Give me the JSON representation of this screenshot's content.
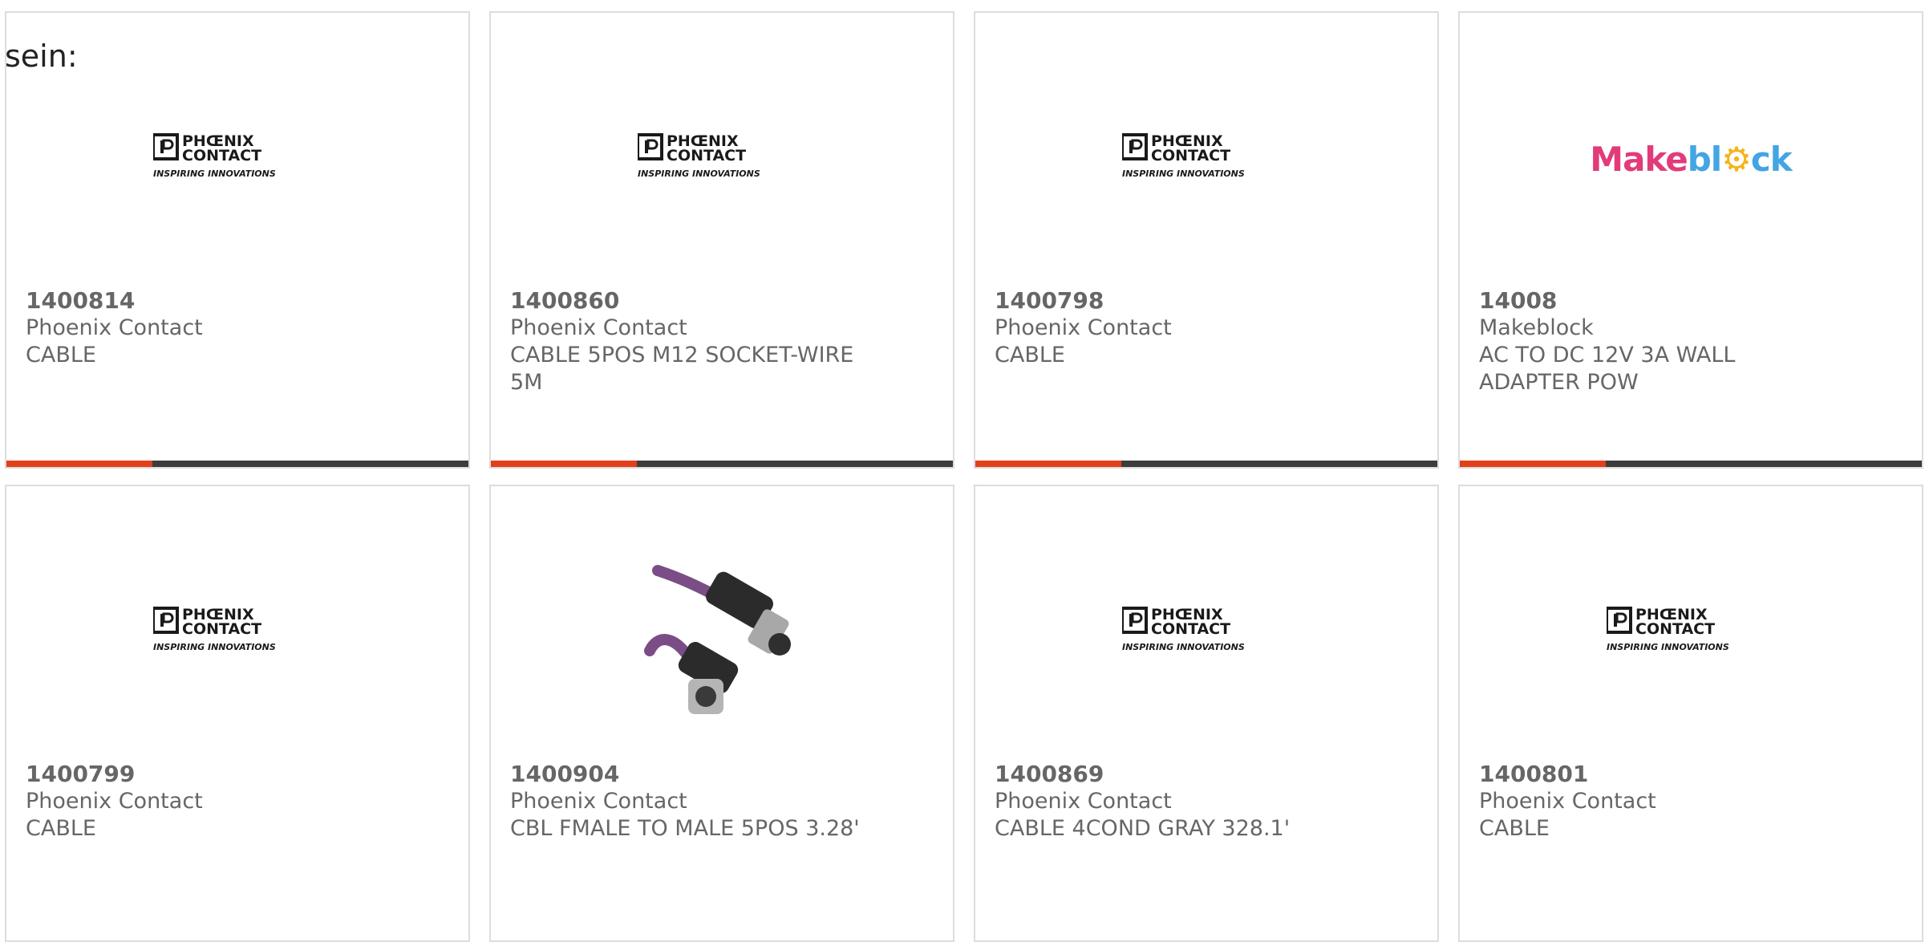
{
  "intro_text": "sein:",
  "logo_texts": {
    "phoenix_line1": "PHŒNIX",
    "phoenix_line2": "CONTACT",
    "phoenix_tagline": "INSPIRING INNOVATIONS",
    "makeblock_parts": [
      "Make",
      "bl",
      "⚙",
      "ck"
    ]
  },
  "products": [
    {
      "part_number": "1400814",
      "manufacturer": "Phoenix Contact",
      "description": "CABLE",
      "image": "phoenix-contact-logo"
    },
    {
      "part_number": "1400860",
      "manufacturer": "Phoenix Contact",
      "description": "CABLE 5POS M12 SOCKET-WIRE 5M",
      "image": "phoenix-contact-logo"
    },
    {
      "part_number": "1400798",
      "manufacturer": "Phoenix Contact",
      "description": "CABLE",
      "image": "phoenix-contact-logo"
    },
    {
      "part_number": "14008",
      "manufacturer": "Makeblock",
      "description": "AC TO DC 12V 3A WALL ADAPTER POW",
      "image": "makeblock-logo"
    },
    {
      "part_number": "1400799",
      "manufacturer": "Phoenix Contact",
      "description": "CABLE",
      "image": "phoenix-contact-logo"
    },
    {
      "part_number": "1400904",
      "manufacturer": "Phoenix Contact",
      "description": "CBL FMALE TO MALE 5POS 3.28'",
      "image": "m12-cable-photo"
    },
    {
      "part_number": "1400869",
      "manufacturer": "Phoenix Contact",
      "description": "CABLE 4COND GRAY 328.1'",
      "image": "phoenix-contact-logo"
    },
    {
      "part_number": "1400801",
      "manufacturer": "Phoenix Contact",
      "description": "CABLE",
      "image": "phoenix-contact-logo"
    }
  ],
  "colors": {
    "accent": "#e2401b",
    "bar": "#3c3c3c",
    "text": "#666666",
    "border": "#dddddd"
  }
}
